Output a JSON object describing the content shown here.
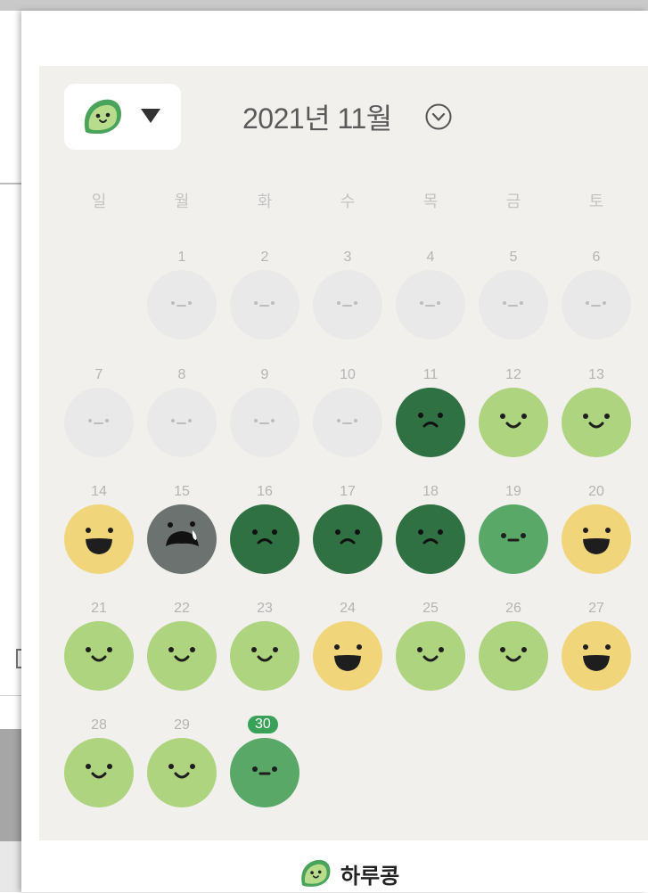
{
  "header": {
    "month_title": "2021년 11월",
    "picker_icon": "leaf-character-icon",
    "picker_caret": "caret-down-icon",
    "month_chevron": "chevron-down-circle-icon"
  },
  "weekdays": [
    "일",
    "월",
    "화",
    "수",
    "목",
    "금",
    "토"
  ],
  "calendar": {
    "today": "30",
    "days": [
      {
        "day": "1",
        "mood": "empty"
      },
      {
        "day": "2",
        "mood": "empty"
      },
      {
        "day": "3",
        "mood": "empty"
      },
      {
        "day": "4",
        "mood": "empty"
      },
      {
        "day": "5",
        "mood": "empty"
      },
      {
        "day": "6",
        "mood": "empty"
      },
      {
        "day": "7",
        "mood": "empty"
      },
      {
        "day": "8",
        "mood": "empty"
      },
      {
        "day": "9",
        "mood": "empty"
      },
      {
        "day": "10",
        "mood": "empty"
      },
      {
        "day": "11",
        "mood": "sad"
      },
      {
        "day": "12",
        "mood": "happy"
      },
      {
        "day": "13",
        "mood": "happy"
      },
      {
        "day": "14",
        "mood": "joyful"
      },
      {
        "day": "15",
        "mood": "crying"
      },
      {
        "day": "16",
        "mood": "sad"
      },
      {
        "day": "17",
        "mood": "sad"
      },
      {
        "day": "18",
        "mood": "sad"
      },
      {
        "day": "19",
        "mood": "neutral"
      },
      {
        "day": "20",
        "mood": "joyful"
      },
      {
        "day": "21",
        "mood": "happy"
      },
      {
        "day": "22",
        "mood": "happy"
      },
      {
        "day": "23",
        "mood": "happy"
      },
      {
        "day": "24",
        "mood": "joyful"
      },
      {
        "day": "25",
        "mood": "happy"
      },
      {
        "day": "26",
        "mood": "happy"
      },
      {
        "day": "27",
        "mood": "joyful"
      },
      {
        "day": "28",
        "mood": "happy"
      },
      {
        "day": "29",
        "mood": "happy"
      },
      {
        "day": "30",
        "mood": "neutral"
      }
    ]
  },
  "mood_colors": {
    "empty": "#e9e9e9",
    "happy": "#aed47f",
    "joyful": "#f1d57a",
    "neutral": "#5aa867",
    "sad": "#2f7143",
    "crying": "#6b726f"
  },
  "footer": {
    "app_name": "하루콩",
    "logo_icon": "leaf-character-icon"
  }
}
